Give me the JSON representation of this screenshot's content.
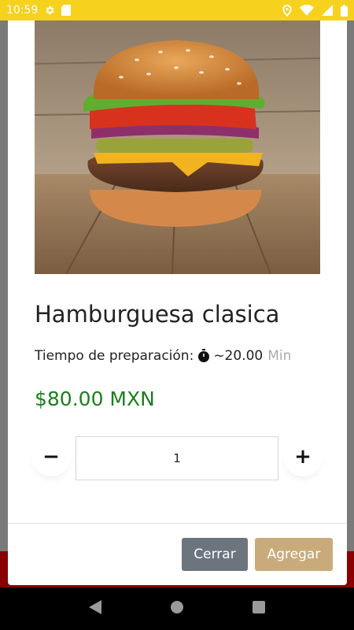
{
  "status_bar": {
    "time": "10:59",
    "icons": [
      "gear-icon",
      "sd-card-icon",
      "location-icon",
      "wifi-icon",
      "signal-icon",
      "battery-icon"
    ]
  },
  "product": {
    "image_icon": "hamburger-photo",
    "name": "Hamburguesa clasica",
    "prep_label": "Tiempo de preparación:",
    "prep_time": "~20.00",
    "prep_unit": "Min",
    "price": "$80.00 MXN"
  },
  "quantity": {
    "minus_label": "−",
    "plus_label": "+",
    "value": "1"
  },
  "actions": {
    "close_label": "Cerrar",
    "add_label": "Agregar"
  },
  "colors": {
    "status_bar": "#f6d21f",
    "price": "#1e7e1e",
    "close_button": "#6c757d",
    "add_button": "#c9ab7b"
  }
}
